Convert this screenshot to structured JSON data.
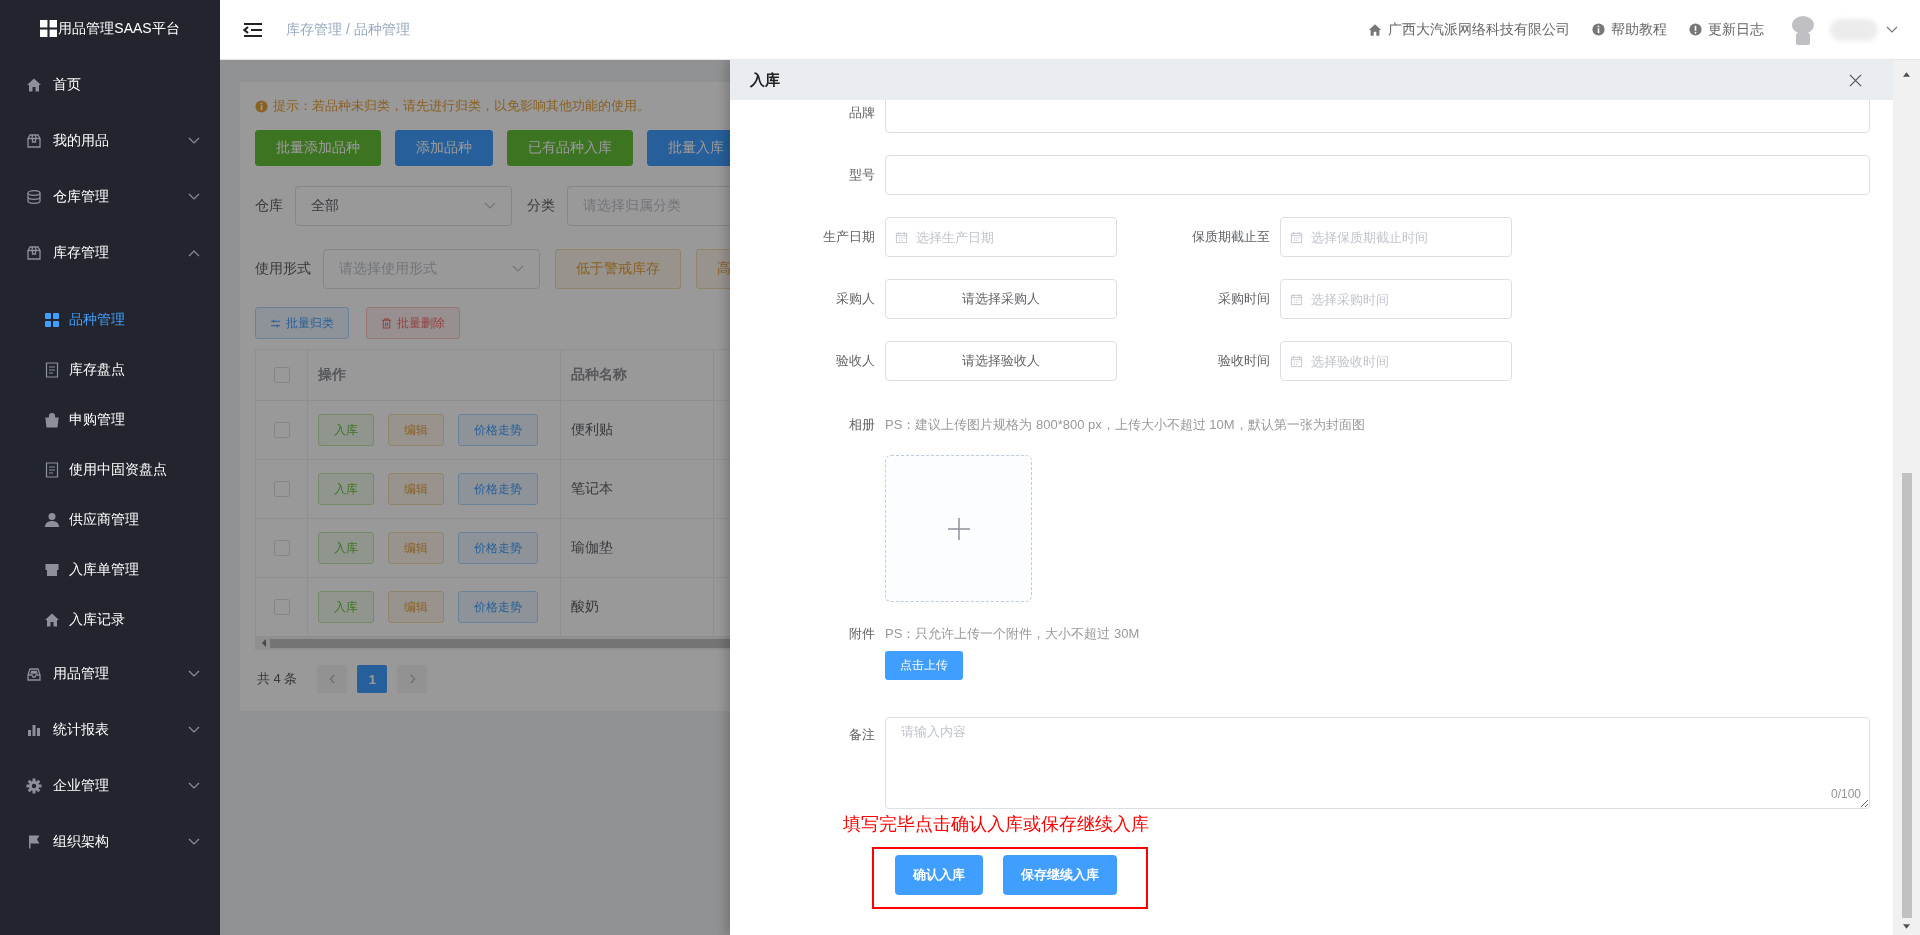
{
  "sidebar": {
    "logo": "用品管理SAAS平台",
    "items": [
      {
        "label": "首页",
        "kind": "link"
      },
      {
        "label": "我的用品",
        "kind": "group",
        "expanded": false
      },
      {
        "label": "仓库管理",
        "kind": "group",
        "expanded": false
      },
      {
        "label": "库存管理",
        "kind": "group",
        "expanded": true,
        "children": [
          {
            "label": "品种管理",
            "selected": true
          },
          {
            "label": "库存盘点",
            "selected": false
          },
          {
            "label": "申购管理",
            "selected": false
          },
          {
            "label": "使用中固资盘点",
            "selected": false
          },
          {
            "label": "供应商管理",
            "selected": false
          },
          {
            "label": "入库单管理",
            "selected": false
          },
          {
            "label": "入库记录",
            "selected": false
          }
        ]
      },
      {
        "label": "用品管理",
        "kind": "group",
        "expanded": false
      },
      {
        "label": "统计报表",
        "kind": "group",
        "expanded": false
      },
      {
        "label": "企业管理",
        "kind": "group",
        "expanded": false
      },
      {
        "label": "组织架构",
        "kind": "group",
        "expanded": false
      }
    ]
  },
  "header": {
    "breadcrumb": "库存管理 / 品种管理",
    "links": [
      "广西大汽派网络科技有限公司",
      "帮助教程",
      "更新日志"
    ]
  },
  "page": {
    "tip": "提示：若品种未归类，请先进行归类，以免影响其他功能的使用。",
    "buttons": [
      {
        "label": "批量添加品种",
        "kind": "success"
      },
      {
        "label": "添加品种",
        "kind": "primary"
      },
      {
        "label": "已有品种入库",
        "kind": "success"
      },
      {
        "label": "批量入库",
        "kind": "primary"
      }
    ],
    "filters": [
      {
        "label": "仓库",
        "value": "全部"
      },
      {
        "label": "分类",
        "placeholder": "请选择归属分类"
      }
    ],
    "usage_filter": {
      "label": "使用形式",
      "placeholder": "请选择使用形式"
    },
    "stock_tags": [
      "低于警戒库存",
      "高"
    ],
    "batch_buttons": [
      {
        "label": "批量归类",
        "kind": "primary"
      },
      {
        "label": "批量删除",
        "kind": "danger"
      }
    ],
    "table": {
      "columns": [
        "操作",
        "品种名称"
      ],
      "header_checked": false,
      "rows": [
        {
          "checked": false,
          "actions": [
            "入库",
            "编辑",
            "价格走势"
          ],
          "name": "便利贴"
        },
        {
          "checked": false,
          "actions": [
            "入库",
            "编辑",
            "价格走势"
          ],
          "name": "笔记本"
        },
        {
          "checked": false,
          "actions": [
            "入库",
            "编辑",
            "价格走势"
          ],
          "name": "瑜伽垫"
        },
        {
          "checked": false,
          "actions": [
            "入库",
            "编辑",
            "价格走势"
          ],
          "name": "酸奶"
        }
      ]
    },
    "pagination": {
      "total": "共 4 条",
      "pages": [
        {
          "label": "1",
          "selected": true
        }
      ]
    }
  },
  "drawer": {
    "title": "入库",
    "form": [
      {
        "kind": "text",
        "label": "品牌"
      },
      {
        "kind": "text",
        "label": "型号"
      },
      {
        "kind": "pair",
        "left": {
          "kind": "date",
          "label": "生产日期",
          "placeholder": "选择生产日期"
        },
        "right": {
          "kind": "date",
          "label": "保质期截止至",
          "placeholder": "选择保质期截止时间"
        }
      },
      {
        "kind": "pair",
        "left": {
          "kind": "picker",
          "label": "采购人",
          "button": "请选择采购人"
        },
        "right": {
          "kind": "date",
          "label": "采购时间",
          "placeholder": "选择采购时间"
        }
      },
      {
        "kind": "pair",
        "left": {
          "kind": "picker",
          "label": "验收人",
          "button": "请选择验收人"
        },
        "right": {
          "kind": "date",
          "label": "验收时间",
          "placeholder": "选择验收时间"
        }
      },
      {
        "kind": "image-upload",
        "label": "相册",
        "hint": "PS：建议上传图片规格为 800*800 px，上传大小不超过 10M，默认第一张为封面图"
      },
      {
        "kind": "file-upload",
        "label": "附件",
        "hint": "PS：只允许上传一个附件，大小不超过 30M",
        "button": "点击上传"
      },
      {
        "kind": "textarea",
        "label": "备注",
        "placeholder": "请输入内容",
        "counter": "0/100"
      }
    ],
    "annotation": "填写完毕点击确认入库或保存继续入库",
    "actions": [
      "确认入库",
      "保存继续入库"
    ]
  }
}
